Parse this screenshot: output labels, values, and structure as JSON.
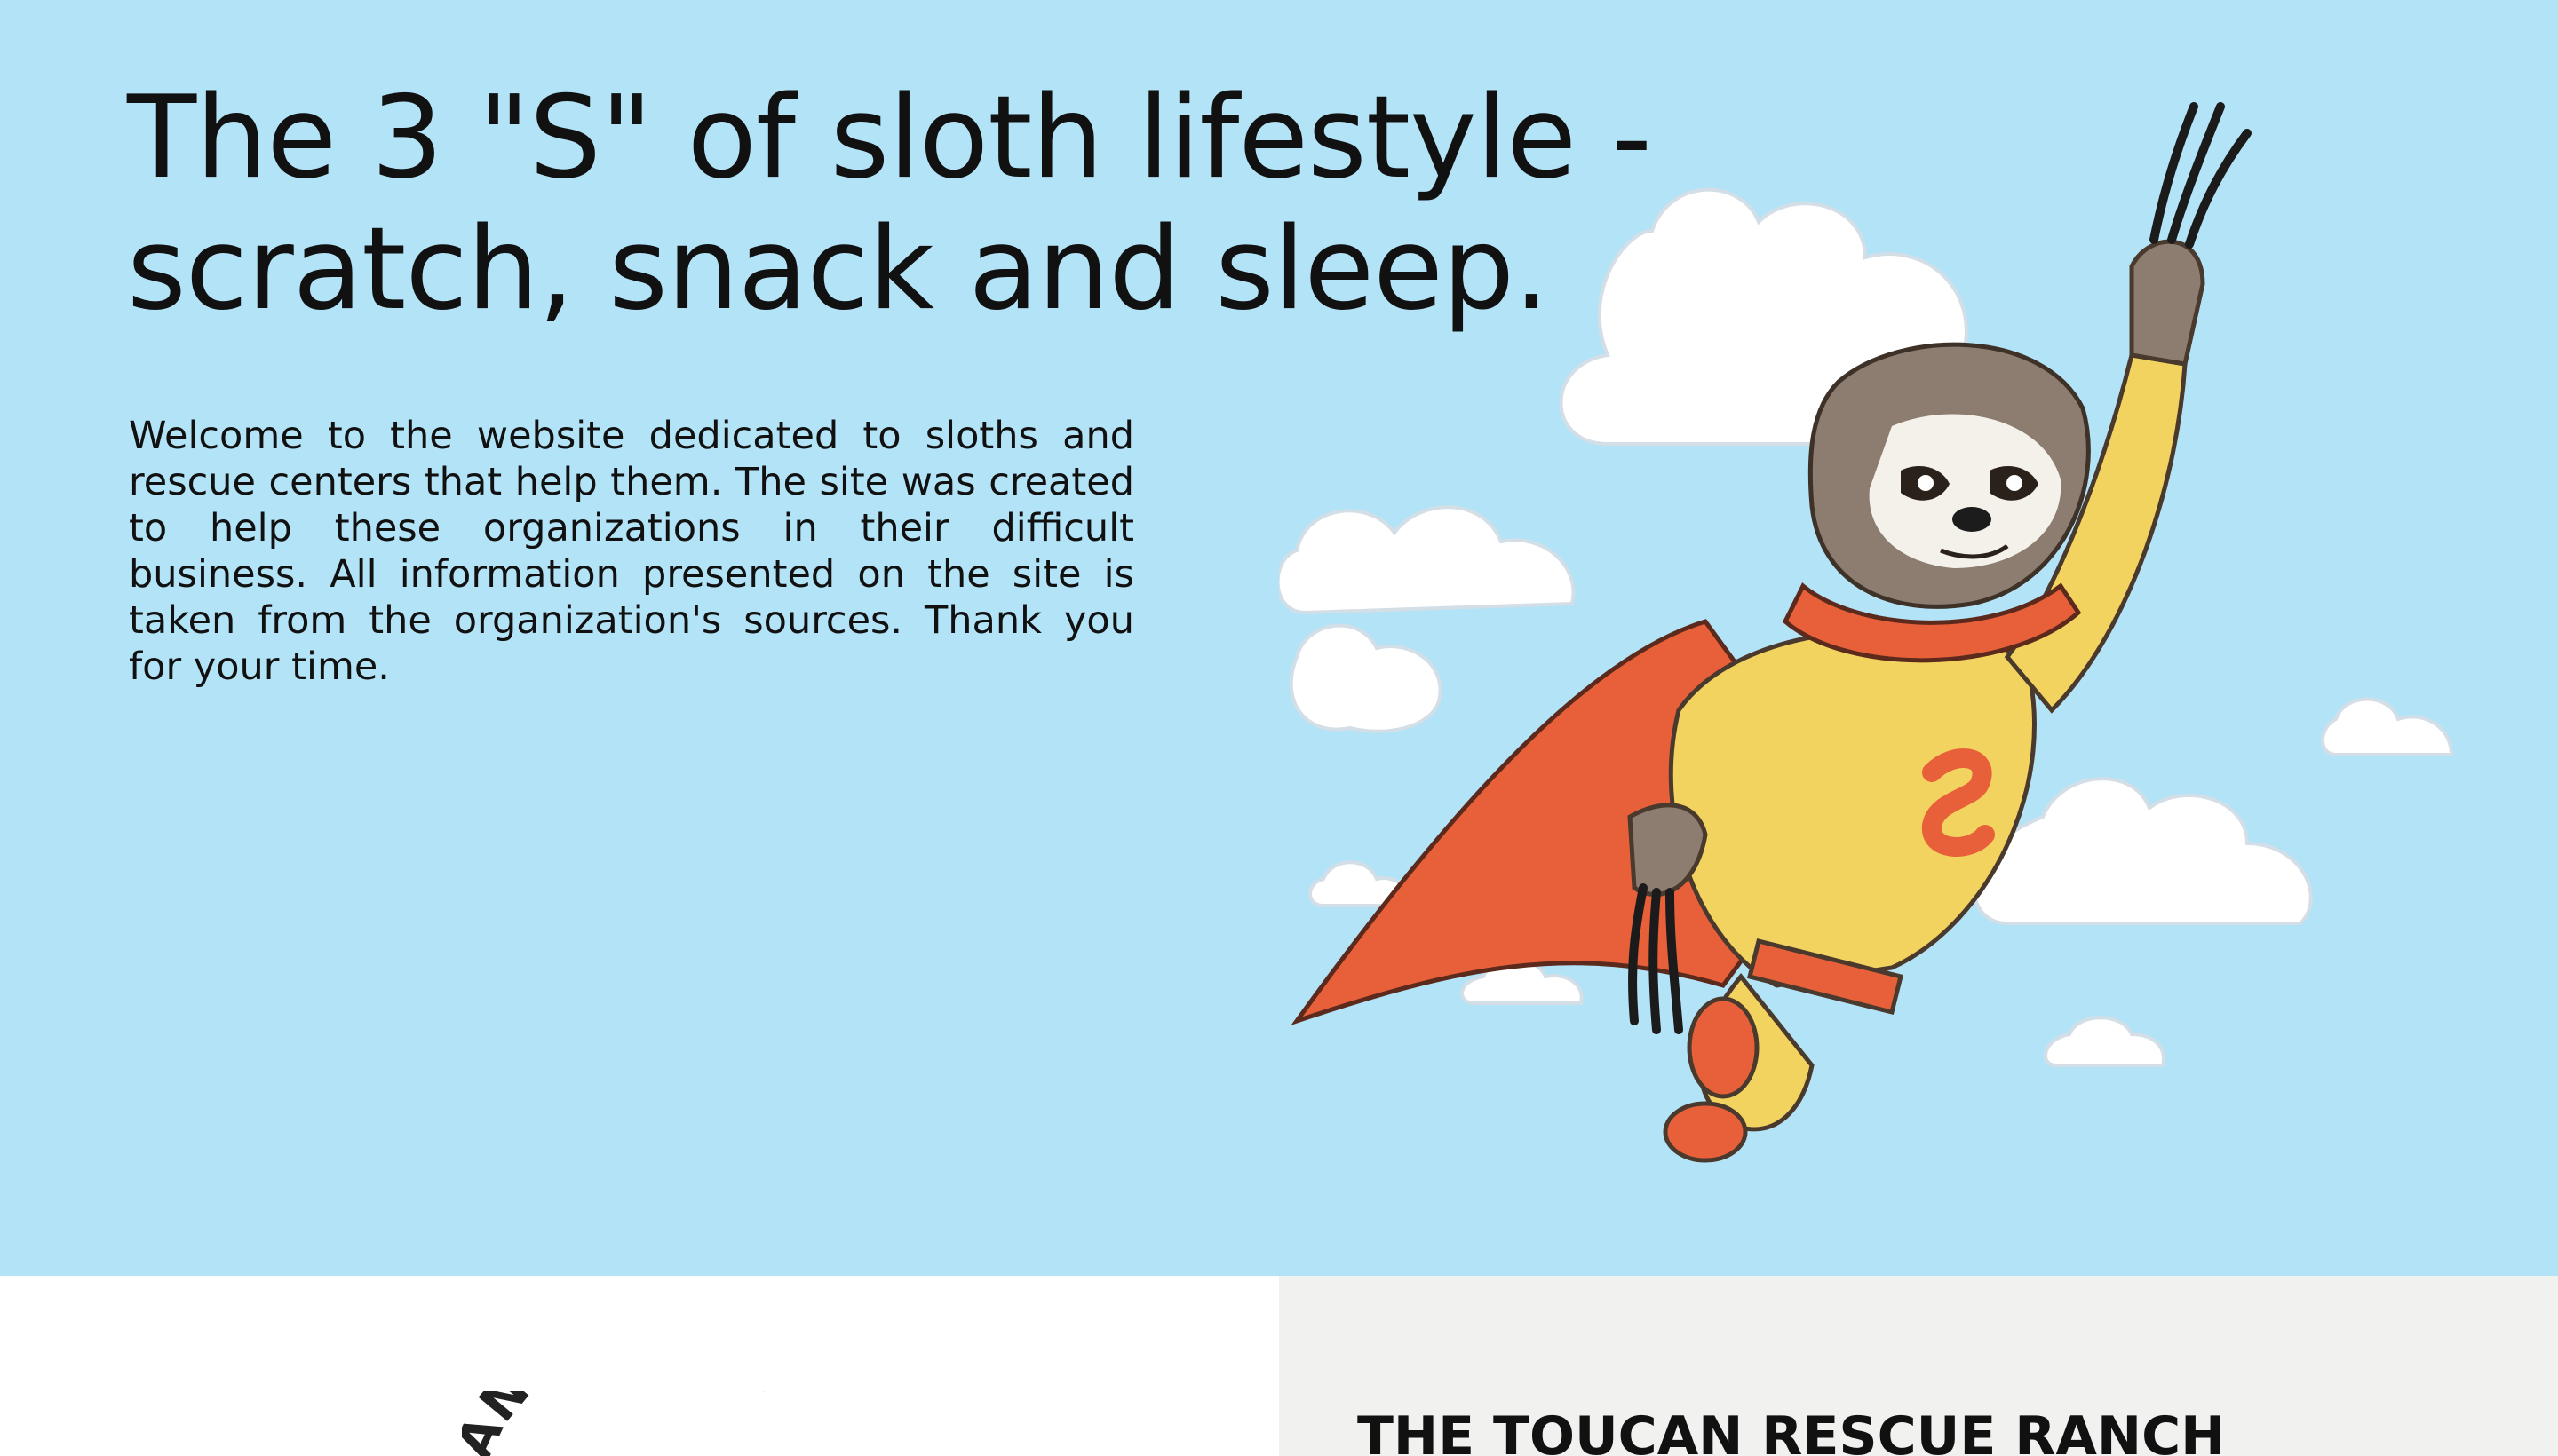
{
  "hero": {
    "title": "The 3 \"S\" of sloth lifestyle - scratch, snack and sleep.",
    "intro": "Welcome to the website dedicated to sloths and rescue centers that help them. The site was created to help these organizations in their difficult business. All information presented on the site is taken from the organization's sources. Thank you for your time.",
    "background_color": "#b3e3f7",
    "illustration_icon": "superhero-sloth-illustration"
  },
  "rescue_section": {
    "logo_text": "AN RESCUE",
    "title": "THE TOUCAN RESCUE RANCH",
    "panel_color": "#f1f1f0"
  },
  "colors": {
    "cape": "#e8603a",
    "suit": "#f3d35f",
    "fur": "#8c7d70",
    "cloud": "#ffffff"
  }
}
